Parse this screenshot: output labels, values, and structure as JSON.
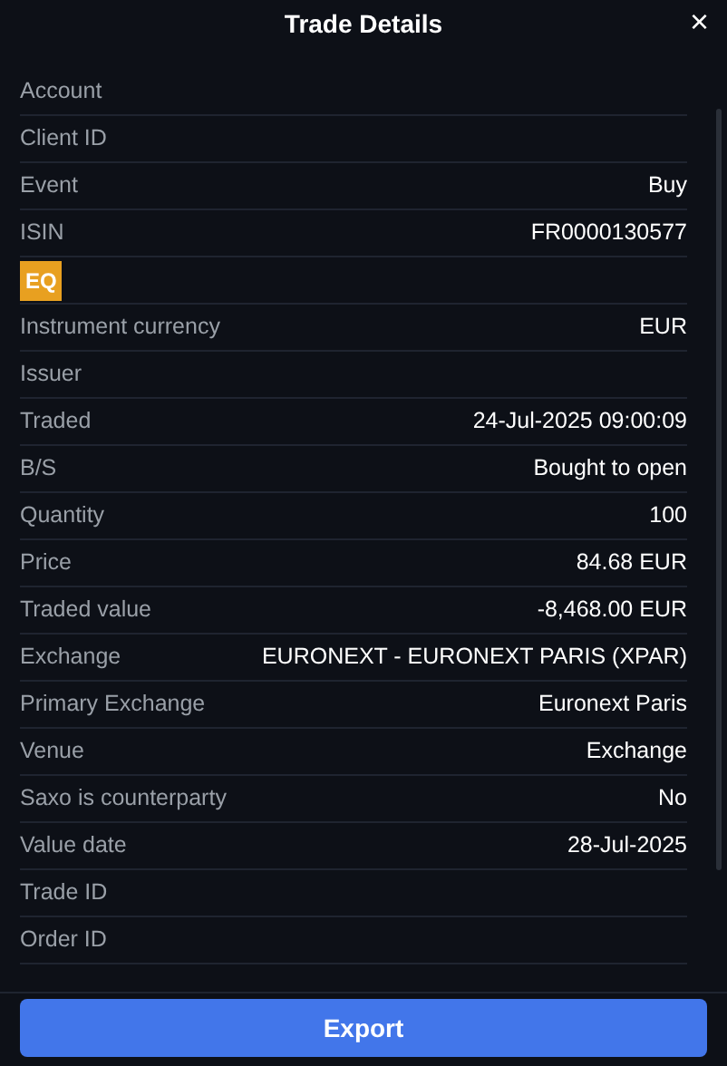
{
  "title": "Trade Details",
  "close": "×",
  "rows": [
    {
      "kind": "field",
      "label": "Account"
    },
    {
      "kind": "field",
      "label": "Client ID"
    },
    {
      "kind": "field",
      "label": "Event",
      "value": "Buy"
    },
    {
      "kind": "field",
      "label": "ISIN",
      "value": "FR0000130577"
    },
    {
      "kind": "badge",
      "label": "EQ"
    },
    {
      "kind": "field",
      "label": "Instrument currency",
      "value": "EUR"
    },
    {
      "kind": "field",
      "label": "Issuer"
    },
    {
      "kind": "field",
      "label": "Traded",
      "value": "24-Jul-2025 09:00:09"
    },
    {
      "kind": "field",
      "label": "B/S",
      "value": "Bought to open"
    },
    {
      "kind": "field",
      "label": "Quantity",
      "value": "100"
    },
    {
      "kind": "field",
      "label": "Price",
      "value": "84.68 EUR"
    },
    {
      "kind": "field",
      "label": "Traded value",
      "value": "-8,468.00 EUR"
    },
    {
      "kind": "field",
      "label": "Exchange",
      "value": "EURONEXT - EURONEXT PARIS (XPAR)"
    },
    {
      "kind": "field",
      "label": "Primary Exchange",
      "value": "Euronext Paris"
    },
    {
      "kind": "field",
      "label": "Venue",
      "value": "Exchange"
    },
    {
      "kind": "field",
      "label": "Saxo is counterparty",
      "value": "No"
    },
    {
      "kind": "field",
      "label": "Value date",
      "value": "28-Jul-2025"
    },
    {
      "kind": "field",
      "label": "Trade ID"
    },
    {
      "kind": "field",
      "label": "Order ID"
    }
  ],
  "export_button": "Export"
}
